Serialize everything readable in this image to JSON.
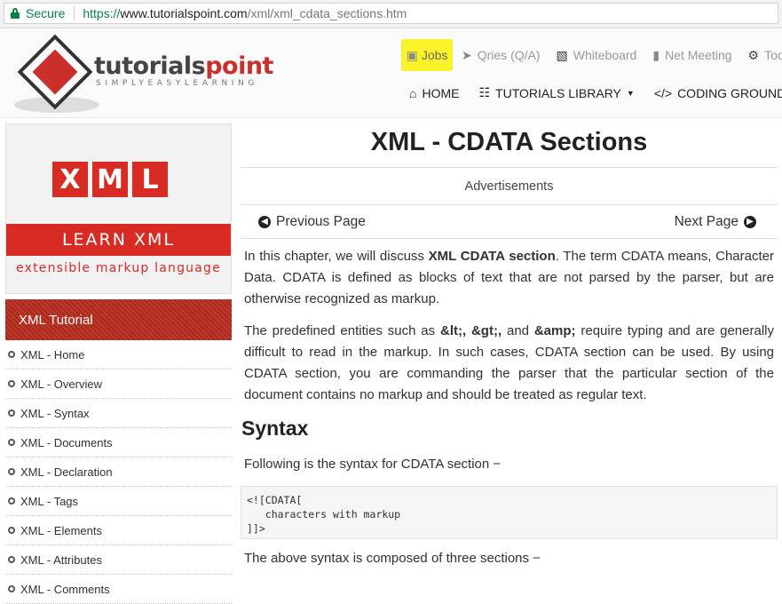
{
  "browser": {
    "secure_label": "Secure",
    "url_scheme": "https://",
    "url_host": "www.tutorialspoint.com",
    "url_path": "/xml/xml_cdata_sections.htm"
  },
  "header": {
    "logo_text_dark": "tutorials",
    "logo_text_red": "point",
    "logo_tagline": "SIMPLYEASYLEARNING",
    "top_nav": [
      {
        "label": "Jobs",
        "icon": "briefcase-icon"
      },
      {
        "label": "Qries (Q/A)",
        "icon": "paper-plane-icon"
      },
      {
        "label": "Whiteboard",
        "icon": "whiteboard-icon"
      },
      {
        "label": "Net Meeting",
        "icon": "video-camera-icon"
      },
      {
        "label": "Too",
        "icon": "gear-icon"
      }
    ],
    "main_nav": [
      {
        "label": "HOME",
        "icon": "home-icon"
      },
      {
        "label": "TUTORIALS LIBRARY",
        "icon": "sitemap-icon"
      },
      {
        "label": "CODING GROUND",
        "icon": "code-icon"
      }
    ]
  },
  "sidebar": {
    "banner_letters": [
      "X",
      "M",
      "L"
    ],
    "banner_learn": "LEARN XML",
    "banner_sub": "extensible markup language",
    "heading": "XML Tutorial",
    "items": [
      "XML - Home",
      "XML - Overview",
      "XML - Syntax",
      "XML - Documents",
      "XML - Declaration",
      "XML - Tags",
      "XML - Elements",
      "XML - Attributes",
      "XML - Comments"
    ]
  },
  "content": {
    "title": "XML - CDATA Sections",
    "advertisements": "Advertisements",
    "prev_label": "Previous Page",
    "next_label": "Next Page",
    "para1": {
      "a": "In this chapter, we will discuss ",
      "b": "XML CDATA section",
      "c": ". The term CDATA means, Character Data. CDATA is defined as blocks of text that are not parsed by the parser, but are otherwise recognized as markup."
    },
    "para2": {
      "a": "The predefined entities such as ",
      "b1": "&lt;, &gt;,",
      "m": " and ",
      "b2": "&amp;",
      "c": " require typing and are generally difficult to read in the markup. In such cases, CDATA section can be used. By using CDATA section, you are commanding the parser that the particular section of the document contains no markup and should be treated as regular text."
    },
    "syntax_heading": "Syntax",
    "para3": "Following is the syntax for CDATA section −",
    "code": "<![CDATA[\n   characters with markup\n]]>",
    "para4": "The above syntax is composed of three sections −"
  }
}
